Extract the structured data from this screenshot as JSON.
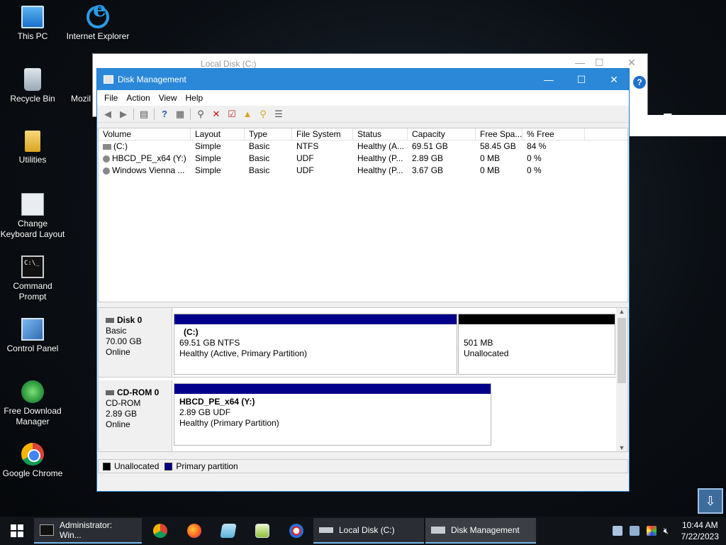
{
  "desktop": {
    "icons": [
      {
        "label": "This PC"
      },
      {
        "label": "Internet Explorer"
      },
      {
        "label": "Recycle Bin"
      },
      {
        "label": "Mozil"
      },
      {
        "label": "Utilities"
      },
      {
        "label": "Change Keyboard Layout"
      },
      {
        "label": "Command Prompt"
      },
      {
        "label": "Control Panel"
      },
      {
        "label": "Free Download Manager"
      },
      {
        "label": "Google Chrome"
      }
    ]
  },
  "background_window": {
    "title": "Local Disk (C:)"
  },
  "disk_management": {
    "title": "Disk Management",
    "controls": {
      "minimize": "—",
      "maximize": "☐",
      "close": "✕"
    },
    "menu": [
      "File",
      "Action",
      "View",
      "Help"
    ],
    "toolbar_icons": [
      "back-icon",
      "forward-icon",
      "properties-icon",
      "help-icon",
      "show-hide-icon",
      "connect-icon",
      "delete-icon",
      "check-icon",
      "folder-up-icon",
      "search-icon",
      "list-icon"
    ],
    "columns": [
      "Volume",
      "Layout",
      "Type",
      "File System",
      "Status",
      "Capacity",
      "Free Spa...",
      "% Free"
    ],
    "volumes": [
      {
        "volume": "(C:)",
        "layout": "Simple",
        "type": "Basic",
        "fs": "NTFS",
        "status": "Healthy (A...",
        "capacity": "69.51 GB",
        "free": "58.45 GB",
        "pct": "84 %"
      },
      {
        "volume": "HBCD_PE_x64 (Y:)",
        "layout": "Simple",
        "type": "Basic",
        "fs": "UDF",
        "status": "Healthy (P...",
        "capacity": "2.89 GB",
        "free": "0 MB",
        "pct": "0 %"
      },
      {
        "volume": "Windows Vienna ...",
        "layout": "Simple",
        "type": "Basic",
        "fs": "UDF",
        "status": "Healthy (P...",
        "capacity": "3.67 GB",
        "free": "0 MB",
        "pct": "0 %"
      }
    ],
    "disks": [
      {
        "name": "Disk 0",
        "kind": "Basic",
        "size": "70.00 GB",
        "state": "Online",
        "partitions": [
          {
            "title": "(C:)",
            "line1": "69.51 GB NTFS",
            "line2": "Healthy (Active, Primary Partition)",
            "color": "#00008b"
          },
          {
            "title": "",
            "line1": "501 MB",
            "line2": "Unallocated",
            "color": "#000000"
          }
        ]
      },
      {
        "name": "CD-ROM 0",
        "kind": "CD-ROM",
        "size": "2.89 GB",
        "state": "Online",
        "partitions": [
          {
            "title": "HBCD_PE_x64  (Y:)",
            "line1": "2.89 GB UDF",
            "line2": "Healthy (Primary Partition)",
            "color": "#00008b"
          }
        ]
      }
    ],
    "legend": [
      {
        "label": "Unallocated",
        "color": "#000000"
      },
      {
        "label": "Primary partition",
        "color": "#00008b"
      }
    ]
  },
  "taskbar": {
    "items": [
      {
        "label": "Administrator: Win..."
      },
      {
        "label": "Local Disk (C:)"
      },
      {
        "label": "Disk Management"
      }
    ],
    "pinned_icons": [
      "chrome-icon",
      "firefox-icon",
      "notepad-icon",
      "editor-icon",
      "paint-icon"
    ],
    "clock": {
      "time": "10:44 AM",
      "date": "7/22/2023"
    }
  }
}
